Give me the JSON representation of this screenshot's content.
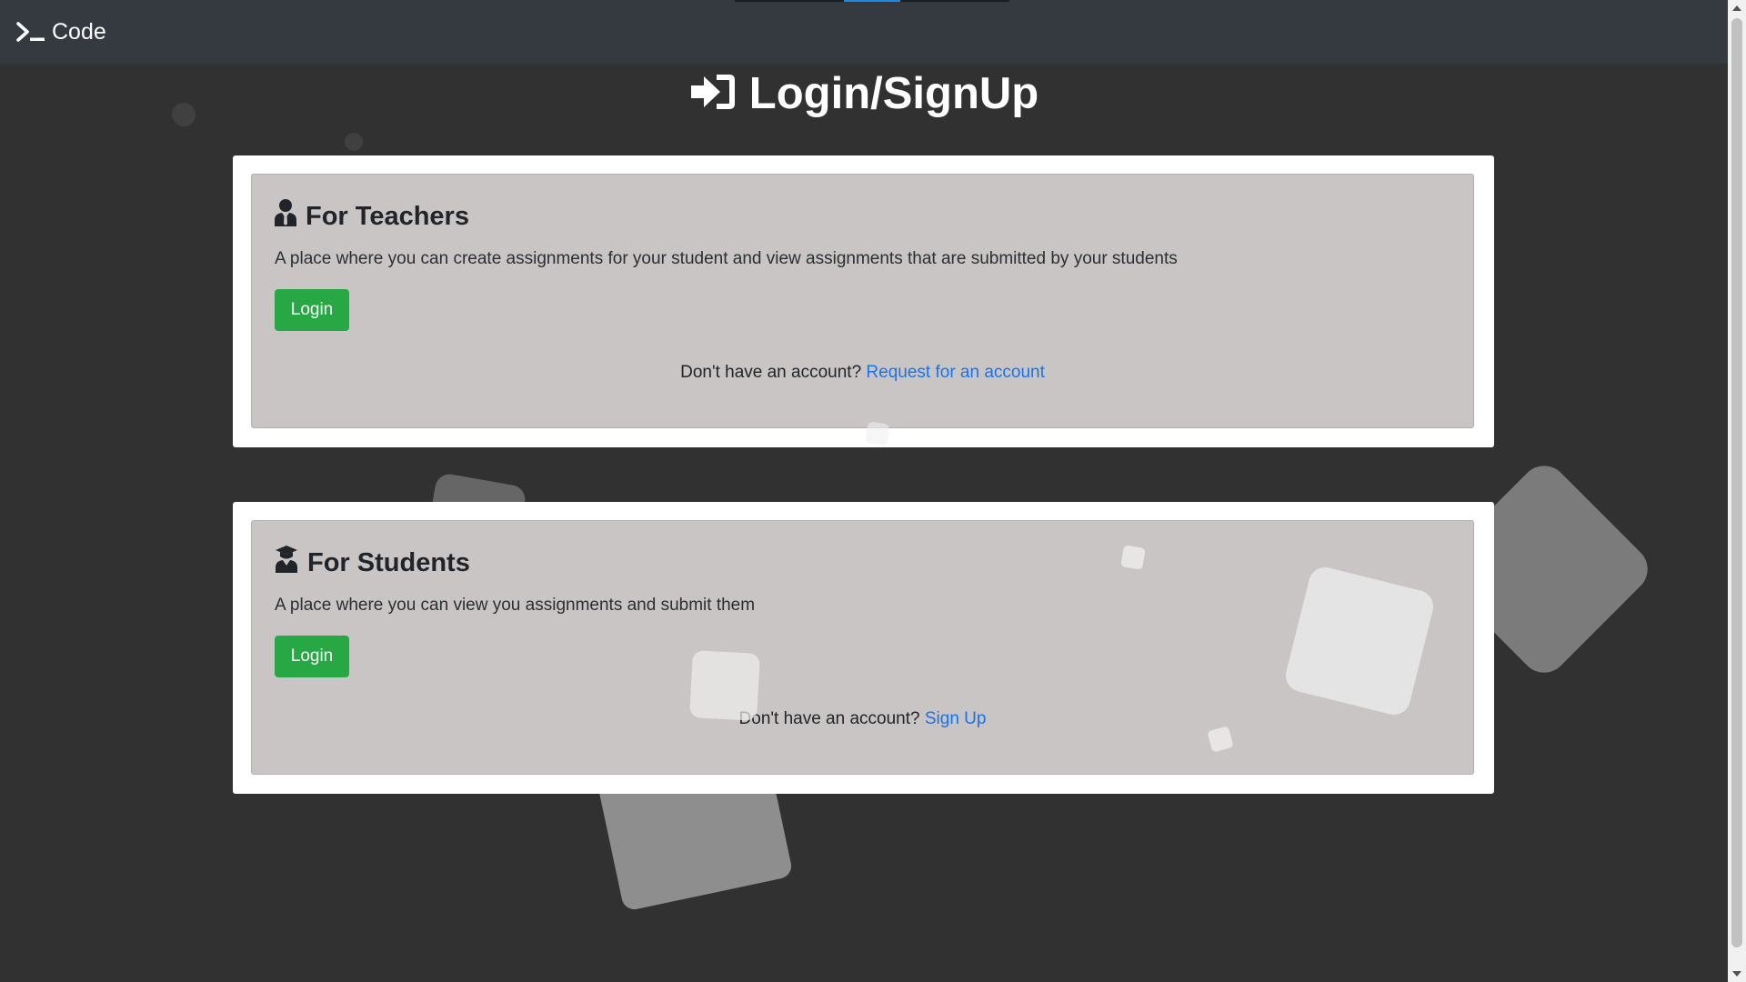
{
  "navbar": {
    "brand_icon": "terminal-icon",
    "brand_text": "Code"
  },
  "heading": {
    "icon": "sign-in-icon",
    "title": "Login/SignUp"
  },
  "teachers": {
    "icon": "teacher-icon",
    "title": "For Teachers",
    "description": "A place where you can create assignments for your student and view assignments that are submitted by your students",
    "login_label": "Login",
    "account_prompt": "Don't have an account?",
    "account_link": "Request for an account"
  },
  "students": {
    "icon": "graduate-icon",
    "title": "For Students",
    "description": "A place where you can view you assignments and submit them",
    "login_label": "Login",
    "account_prompt": "Don't have an account?",
    "account_link": "Sign Up"
  },
  "colors": {
    "background": "#313131",
    "navbar": "#343a40",
    "card_panel": "#c9c5c4",
    "login_button": "#28a745",
    "link": "#1a73e8"
  }
}
